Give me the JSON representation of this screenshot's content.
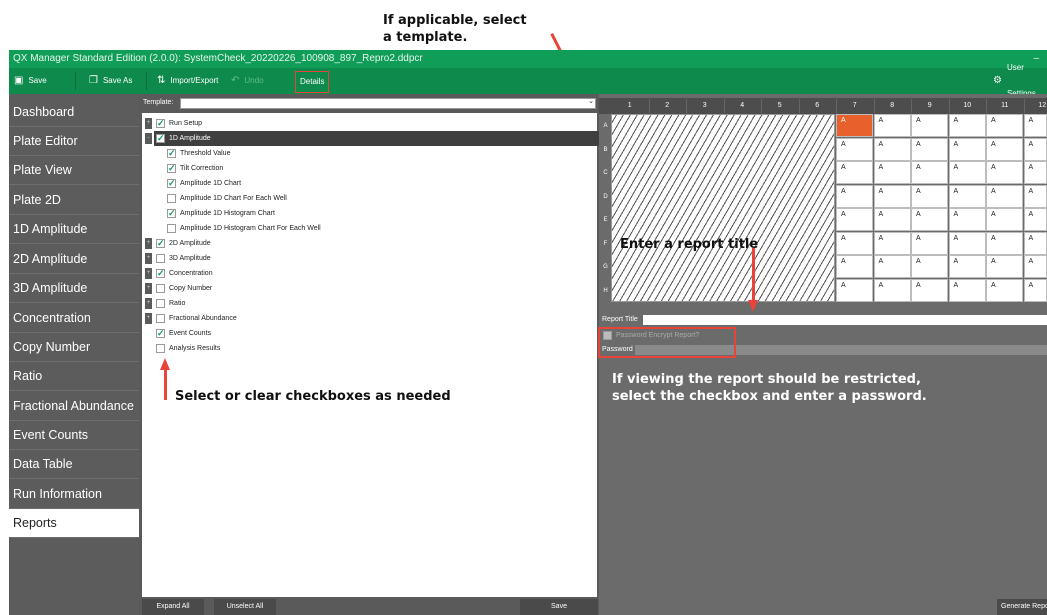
{
  "annotations": {
    "template_hint": "If applicable, select a template.",
    "template_hint_line1": "If applicable, select",
    "template_hint_line2": "a template.",
    "checkbox_hint": "Select or clear checkboxes as needed",
    "report_title_hint": "Enter a report title",
    "password_hint_line1": "If viewing the report should be restricted,",
    "password_hint_line2": "select the checkbox and enter a password."
  },
  "window": {
    "title": "QX Manager Standard Edition (2.0.0): SystemCheck_20220226_100908_897_Repro2.ddpcr",
    "minimize": "–"
  },
  "toolbar": {
    "save": "Save",
    "save_as": "Save As",
    "import_export": "Import/Export",
    "undo": "Undo",
    "details": "Details",
    "user_settings": "User Settings"
  },
  "sidebar": {
    "items": [
      {
        "label": "Dashboard"
      },
      {
        "label": "Plate Editor"
      },
      {
        "label": "Plate View"
      },
      {
        "label": "Plate 2D"
      },
      {
        "label": "1D Amplitude"
      },
      {
        "label": "2D Amplitude"
      },
      {
        "label": "3D Amplitude"
      },
      {
        "label": "Concentration"
      },
      {
        "label": "Copy Number"
      },
      {
        "label": "Ratio"
      },
      {
        "label": "Fractional Abundance"
      },
      {
        "label": "Event Counts"
      },
      {
        "label": "Data Table"
      },
      {
        "label": "Run Information"
      },
      {
        "label": "Reports"
      }
    ],
    "active": "Reports"
  },
  "template": {
    "label": "Template:",
    "value": ""
  },
  "tree": [
    {
      "label": "Run Setup",
      "checked": true,
      "level": 0,
      "expander": "+"
    },
    {
      "label": "1D Amplitude",
      "checked": true,
      "level": 0,
      "expander": "-",
      "selected": true
    },
    {
      "label": "Threshold Value",
      "checked": true,
      "level": 1
    },
    {
      "label": "Tilt Correction",
      "checked": true,
      "level": 1
    },
    {
      "label": "Amplitude 1D Chart",
      "checked": true,
      "level": 1
    },
    {
      "label": "Amplitude 1D Chart For Each Well",
      "checked": false,
      "level": 1
    },
    {
      "label": "Amplitude 1D Histogram Chart",
      "checked": true,
      "level": 1
    },
    {
      "label": "Amplitude 1D Histogram Chart For Each Well",
      "checked": false,
      "level": 1
    },
    {
      "label": "2D Amplitude",
      "checked": true,
      "level": 0,
      "expander": "+"
    },
    {
      "label": "3D Amplitude",
      "checked": false,
      "level": 0,
      "expander": "+"
    },
    {
      "label": "Concentration",
      "checked": true,
      "level": 0,
      "expander": "+"
    },
    {
      "label": "Copy Number",
      "checked": false,
      "level": 0,
      "expander": "+"
    },
    {
      "label": "Ratio",
      "checked": false,
      "level": 0,
      "expander": "+"
    },
    {
      "label": "Fractional Abundance",
      "checked": false,
      "level": 0,
      "expander": "+"
    },
    {
      "label": "Event Counts",
      "checked": true,
      "level": 0
    },
    {
      "label": "Analysis Results",
      "checked": false,
      "level": 0
    }
  ],
  "bottom_buttons": {
    "expand_all": "Expand All",
    "unselect_all": "Unselect All",
    "save": "Save",
    "generate_report": "Generate Report"
  },
  "plate": {
    "columns": [
      "1",
      "2",
      "3",
      "4",
      "5",
      "6",
      "7",
      "8",
      "9",
      "10",
      "11",
      "12"
    ],
    "rows": [
      "A",
      "B",
      "C",
      "D",
      "E",
      "F",
      "G",
      "H"
    ],
    "well_text": "A",
    "first_data_column": "7",
    "selected_well": "A7",
    "selected_color": "#e8612c"
  },
  "report": {
    "title_label": "Report Title",
    "title_value": "",
    "encrypt_label": "Password Encrypt Report?",
    "encrypt_checked": false,
    "password_label": "Password",
    "password_value": ""
  },
  "colors": {
    "brand_green": "#0f9d58",
    "annotation_red": "#e8443a"
  }
}
